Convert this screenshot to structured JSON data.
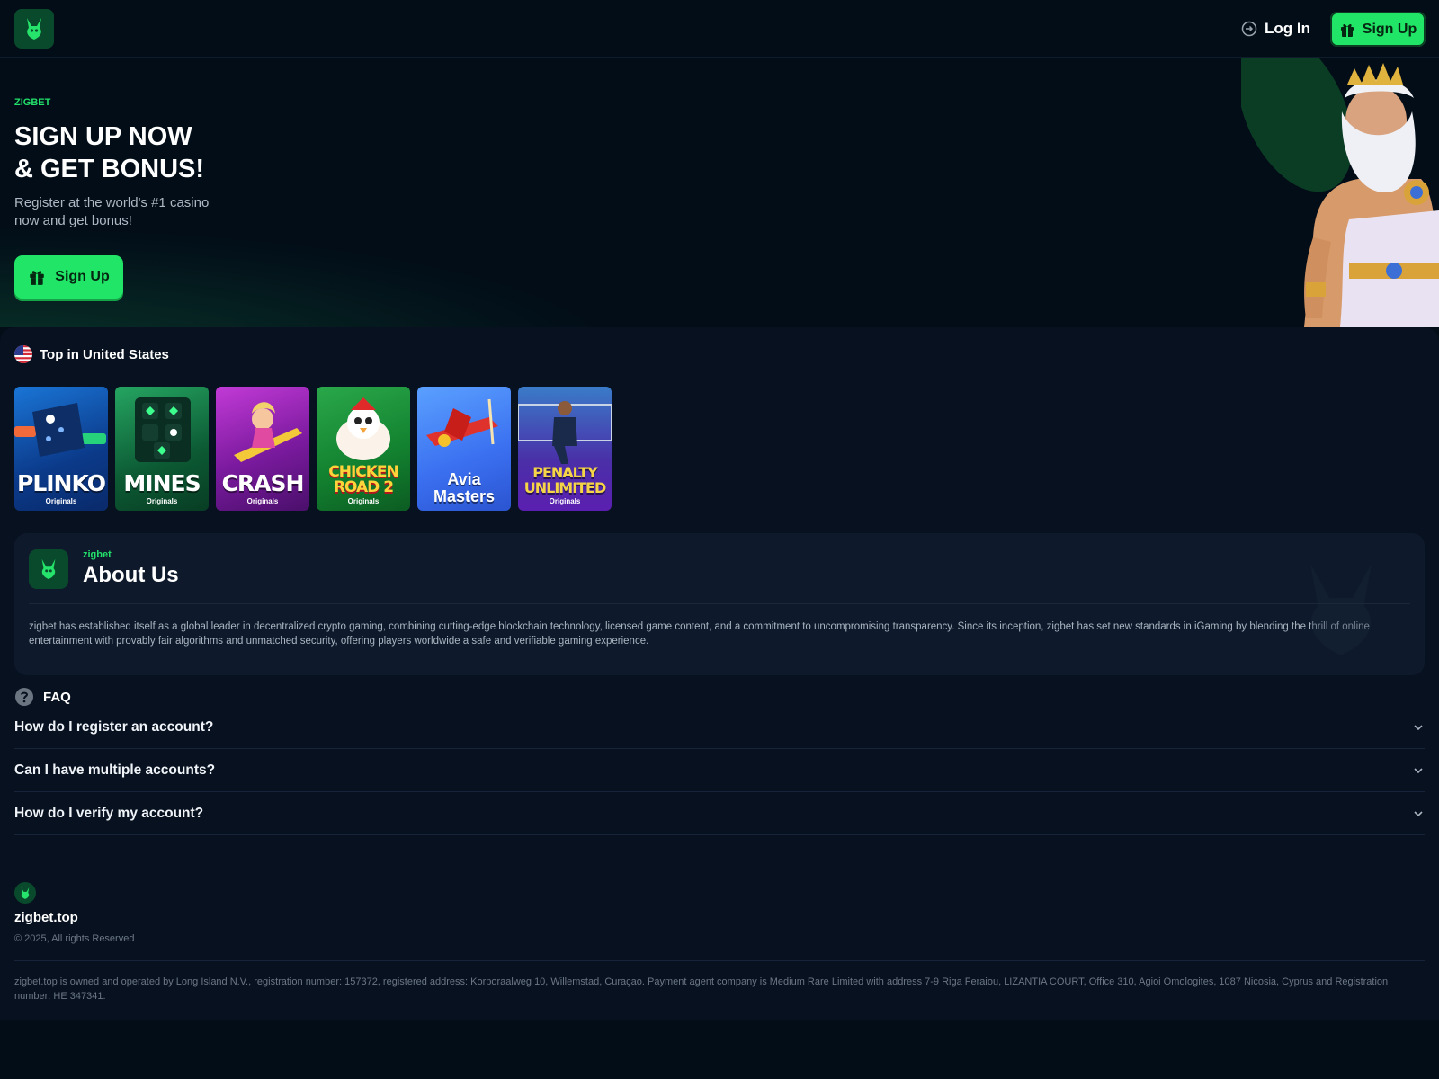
{
  "colors": {
    "accent": "#21e566",
    "background": "#020d18",
    "panel": "#0e1a2c"
  },
  "header": {
    "logo_icon": "rabbit-logo-icon",
    "login_label": "Log In",
    "login_icon": "login-arrow-icon",
    "signup_label": "Sign Up",
    "signup_icon": "gift-icon"
  },
  "hero": {
    "brand": "ZIGBET",
    "title_line1": "SIGN UP NOW",
    "title_line2": "& GET BONUS!",
    "subtitle": "Register at the world's #1 casino now and get bonus!",
    "signup_label": "Sign Up",
    "signup_icon": "gift-icon"
  },
  "top_games": {
    "title": "Top in United States",
    "flag_icon": "us-flag-icon",
    "games": [
      {
        "name": "PLINKO",
        "tag": "Originals"
      },
      {
        "name": "MINES",
        "tag": "Originals"
      },
      {
        "name": "CRASH",
        "tag": "Originals"
      },
      {
        "name": "CHICKEN ROAD 2",
        "tag": "Originals"
      },
      {
        "name": "Avia Masters",
        "tag": ""
      },
      {
        "name": "PENALTY UNLIMITED",
        "tag": "Originals"
      }
    ]
  },
  "about": {
    "brand": "zigbet",
    "title": "About Us",
    "text": "zigbet has established itself as a global leader in decentralized crypto gaming, combining cutting-edge blockchain technology, licensed game content, and a commitment to uncompromising transparency. Since its inception, zigbet has set new standards in iGaming by blending the thrill of online entertainment with provably fair algorithms and unmatched security, offering players worldwide a safe and verifiable gaming experience."
  },
  "faq": {
    "title": "FAQ",
    "icon": "question-circle-icon",
    "items": [
      {
        "question": "How do I register an account?"
      },
      {
        "question": "Can I have multiple accounts?"
      },
      {
        "question": "How do I verify my account?"
      }
    ]
  },
  "footer": {
    "site": "zigbet.top",
    "copyright": "© 2025, All rights Reserved",
    "legal": "zigbet.top is owned and operated by Long Island N.V., registration number: 157372, registered address: Korporaalweg 10, Willemstad, Curaçao. Payment agent company is Medium Rare Limited with address 7-9 Riga Feraiou, LIZANTIA COURT, Office 310, Agioi Omologites, 1087 Nicosia, Cyprus and Registration number: HE 347341."
  }
}
